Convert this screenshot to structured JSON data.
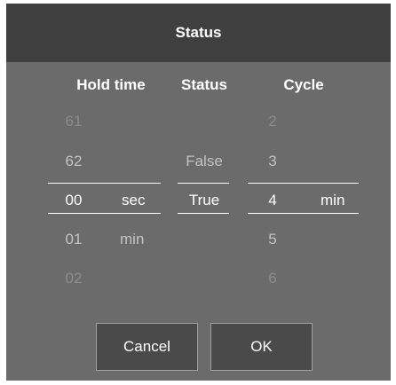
{
  "dialog": {
    "title": "Status",
    "columns": {
      "hold_time": "Hold time",
      "status": "Status",
      "cycle": "Cycle"
    },
    "hold_time": {
      "values": [
        "61",
        "62",
        "00",
        "01",
        "02"
      ],
      "selected_value": "00",
      "unit_selected": "sec",
      "unit_next": "min"
    },
    "status": {
      "values": [
        "False",
        "True"
      ],
      "selected_value": "True"
    },
    "cycle": {
      "values": [
        "2",
        "3",
        "4",
        "5",
        "6"
      ],
      "selected_value": "4",
      "unit_selected": "min"
    },
    "buttons": {
      "cancel": "Cancel",
      "ok": "OK"
    },
    "colors": {
      "title_bar": "#3f3f3f",
      "background": "#6b6b6b",
      "button": "#4a4a4a",
      "selected_text": "#ffffff"
    }
  }
}
